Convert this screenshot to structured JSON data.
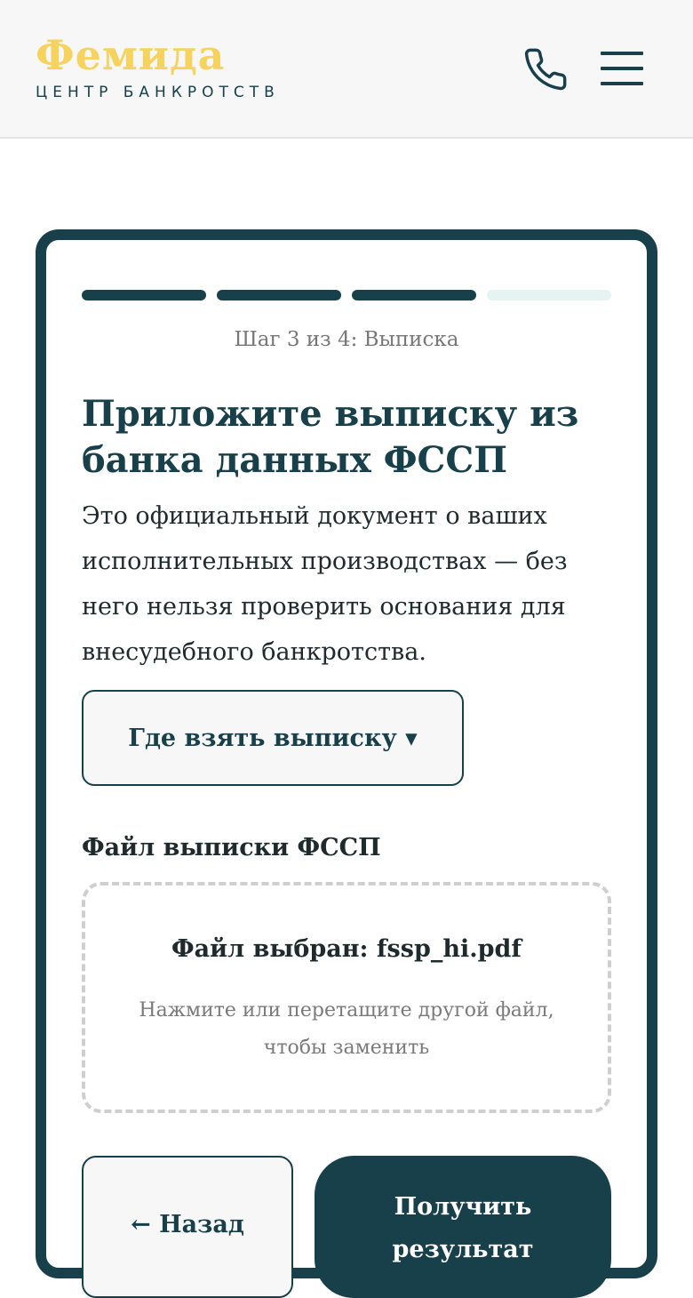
{
  "header": {
    "logo": "Фемида",
    "subtitle": "ЦЕНТР БАНКРОТСТВ",
    "phone_icon": "phone-icon",
    "menu_icon": "hamburger-menu-icon"
  },
  "form": {
    "steps_total": 4,
    "steps_completed": 3,
    "step_label": "Шаг 3 из 4: Выписка",
    "title": "Приложите выписку из банка данных ФССП",
    "description": "Это официальный документ о ваших исполнительных производствах — без него нельзя проверить основания для внесудебного банкротства.",
    "where_button": "Где взять выписку ▾",
    "file_label": "Файл выписки ФССП",
    "dropzone_title": "Файл выбран: fssp_hi.pdf",
    "dropzone_hint": "Нажмите или перетащите другой файл, чтобы заменить",
    "back_button": "← Назад",
    "submit_button": "Получить результат"
  },
  "colors": {
    "brand_dark": "#17404a",
    "logo_yellow": "#f6d35e",
    "progress_inactive": "#e6f4f1"
  }
}
